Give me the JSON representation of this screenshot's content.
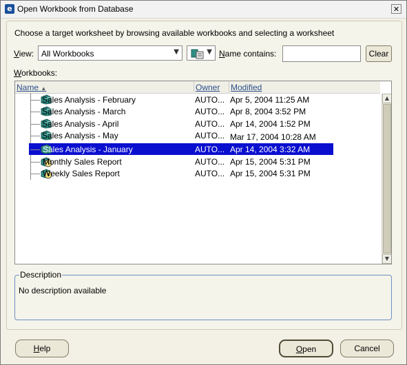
{
  "window": {
    "title": "Open Workbook from Database",
    "close_glyph": "✕",
    "app_icon_glyph": "e"
  },
  "instruction": "Choose a target worksheet by browsing available workbooks and selecting a worksheet",
  "filter": {
    "view_label": "View:",
    "view_value": "All Workbooks",
    "name_contains_label": "Name contains:",
    "name_contains_value": "",
    "clear_label": "Clear"
  },
  "workbooks": {
    "label": "Workbooks:",
    "columns": {
      "name": "Name",
      "owner": "Owner",
      "modified": "Modified",
      "sort_indicator": "▲"
    },
    "rows": [
      {
        "name": "Sales Analysis - February",
        "owner": "AUTO...",
        "modified": "Apr 5, 2004 11:25 AM",
        "icon": "workbook-book-icon",
        "selected": false
      },
      {
        "name": "Sales Analysis - March",
        "owner": "AUTO...",
        "modified": "Apr 8, 2004 3:52 PM",
        "icon": "workbook-book-icon",
        "selected": false
      },
      {
        "name": "Sales Analysis - April",
        "owner": "AUTO...",
        "modified": "Apr 14, 2004 1:52 PM",
        "icon": "workbook-book-icon",
        "selected": false
      },
      {
        "name": "Sales Analysis - May",
        "owner": "AUTO...",
        "modified": "Mar 17, 2004 10:28 AM",
        "icon": "workbook-book-icon",
        "selected": false
      },
      {
        "name": "Sales Analysis - January",
        "owner": "AUTO...",
        "modified": "Apr 14, 2004 3:32 AM",
        "icon": "workbook-book-icon",
        "selected": true
      },
      {
        "name": "Monthly Sales Report",
        "owner": "AUTO...",
        "modified": "Apr 15, 2004 5:31 PM",
        "icon": "scheduled-workbook-icon",
        "selected": false
      },
      {
        "name": "Weekly Sales Report",
        "owner": "AUTO...",
        "modified": "Apr 15, 2004 5:31 PM",
        "icon": "scheduled-workbook-icon",
        "selected": false
      }
    ]
  },
  "description": {
    "legend": "Description",
    "text": "No description available"
  },
  "buttons": {
    "help": "Help",
    "open": "Open",
    "cancel": "Cancel"
  },
  "colors": {
    "selection": "#0a0fcf",
    "book": "#2f8f86",
    "header_link": "#2b4f8a"
  },
  "scrollbar": {
    "up_glyph": "▲",
    "down_glyph": "▼"
  },
  "icons": {
    "dropdown": "chevron-down-icon"
  }
}
